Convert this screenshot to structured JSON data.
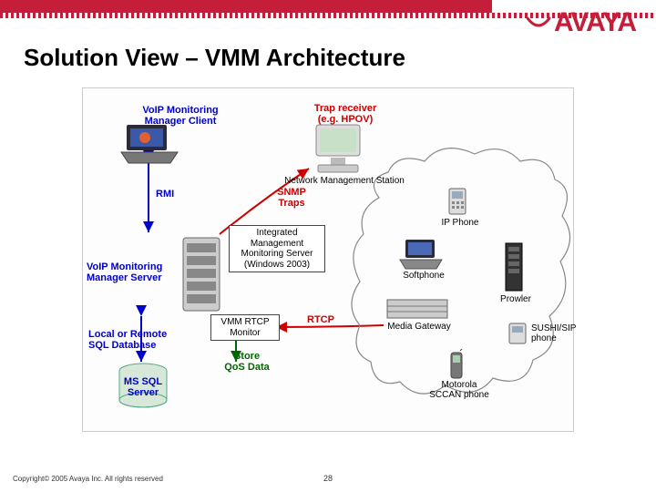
{
  "brand": {
    "name": "AVAYA"
  },
  "slide": {
    "title": "Solution View – VMM Architecture"
  },
  "diagram": {
    "client_label": "VoIP Monitoring\nManager Client",
    "server_label": "VoIP Monitoring\nManager Server",
    "db_label": "Local or Remote\nSQL Database",
    "mssql_label": "MS SQL\nServer",
    "rmi_label": "RMI",
    "integrated_label": "Integrated\nManagement\nMonitoring Server\n(Windows 2003)",
    "vmm_rtcp_label": "VMM RTCP\nMonitor",
    "store_label": "Store\nQoS Data",
    "trap_label": "Trap receiver\n(e.g. HPOV)",
    "nms_label": "Network Management Station",
    "snmp_label": "SNMP\nTraps",
    "rtcp_label": "RTCP",
    "ip_phone_label": "IP Phone",
    "softphone_label": "Softphone",
    "media_gw_label": "Media Gateway",
    "prowler_label": "Prowler",
    "sushi_label": "SUSHI/SIP\nphone",
    "scan_label": "Motorola\nSCCAN phone"
  },
  "footer": {
    "copyright": "Copyright© 2005 Avaya Inc. All rights reserved",
    "page": "28"
  }
}
